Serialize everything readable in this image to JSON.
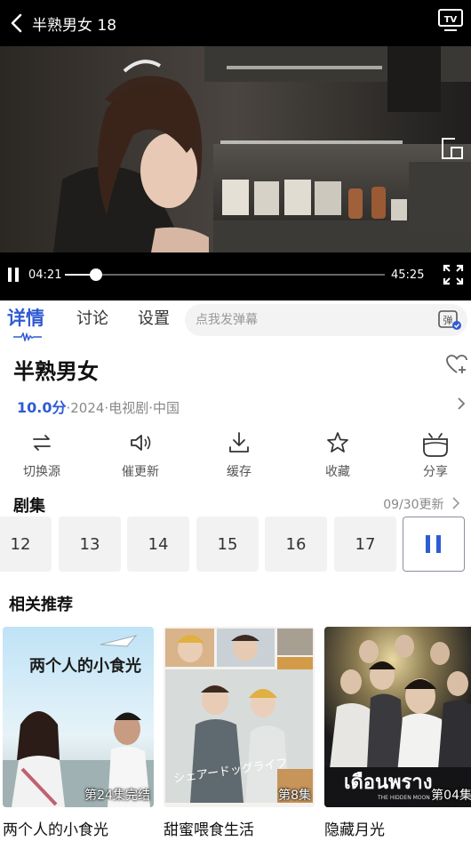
{
  "player": {
    "title": "半熟男女 18",
    "current_time": "04:21",
    "total_time": "45:25",
    "progress": 0.096
  },
  "tabs": [
    {
      "label": "详情",
      "active": true
    },
    {
      "label": "讨论",
      "active": false
    },
    {
      "label": "设置",
      "active": false
    }
  ],
  "danmu": {
    "placeholder": "点我发弹幕",
    "icon_glyph": "弹"
  },
  "show": {
    "title": "半熟男女",
    "score": "10.0分",
    "meta": "·2024·电视剧·中国"
  },
  "actions": [
    {
      "label": "切换源",
      "icon": "switch-source-icon"
    },
    {
      "label": "催更新",
      "icon": "speaker-icon"
    },
    {
      "label": "缓存",
      "icon": "download-icon"
    },
    {
      "label": "收藏",
      "icon": "star-icon"
    },
    {
      "label": "分享",
      "icon": "share-icon"
    }
  ],
  "episodes": {
    "heading": "剧集",
    "update": "09/30更新",
    "items": [
      "12",
      "13",
      "14",
      "15",
      "16",
      "17"
    ],
    "playing_icon": "pause-icon"
  },
  "recommend": {
    "heading": "相关推荐",
    "items": [
      {
        "title": "两个人的小食光",
        "badge": "第24集完结",
        "poster_text": "两个人的小食光"
      },
      {
        "title": "甜蜜喂食生活",
        "badge": "第8集",
        "poster_text": "シェアードッグライフ"
      },
      {
        "title": "隐藏月光",
        "badge": "第04集",
        "poster_text": "เดือนพราง",
        "poster_sub": "THE HIDDEN MOON"
      }
    ]
  },
  "colors": {
    "accent": "#2f5bd3",
    "player_bg": "#000000",
    "episode_bg": "#f2f2f2"
  }
}
